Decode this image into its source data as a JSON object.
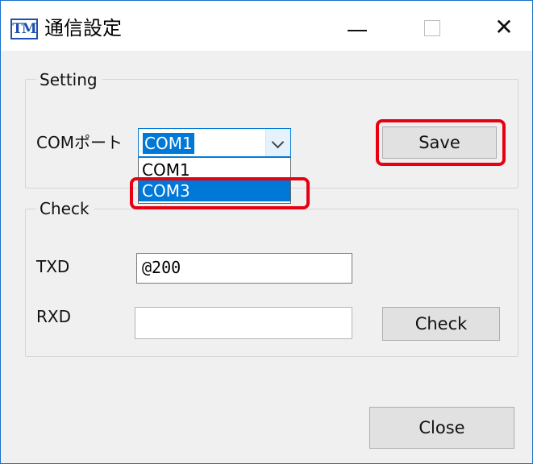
{
  "window": {
    "title": "通信設定",
    "app_icon_text": "TM",
    "controls": {
      "minimize": "—",
      "maximize": "□",
      "close": "✕"
    }
  },
  "setting_group": {
    "legend": "Setting",
    "com_port_label": "COMポート",
    "com_port_value": "COM1",
    "com_port_options": [
      "COM1",
      "COM3"
    ],
    "highlighted_option": "COM3",
    "save_label": "Save"
  },
  "check_group": {
    "legend": "Check",
    "txd_label": "TXD",
    "txd_value": "@200",
    "rxd_label": "RXD",
    "rxd_value": "",
    "check_label": "Check"
  },
  "footer": {
    "close_label": "Close"
  },
  "colors": {
    "selection": "#0078d7",
    "highlight_annotation": "#e60012",
    "window_border": "#1a6fc9"
  }
}
